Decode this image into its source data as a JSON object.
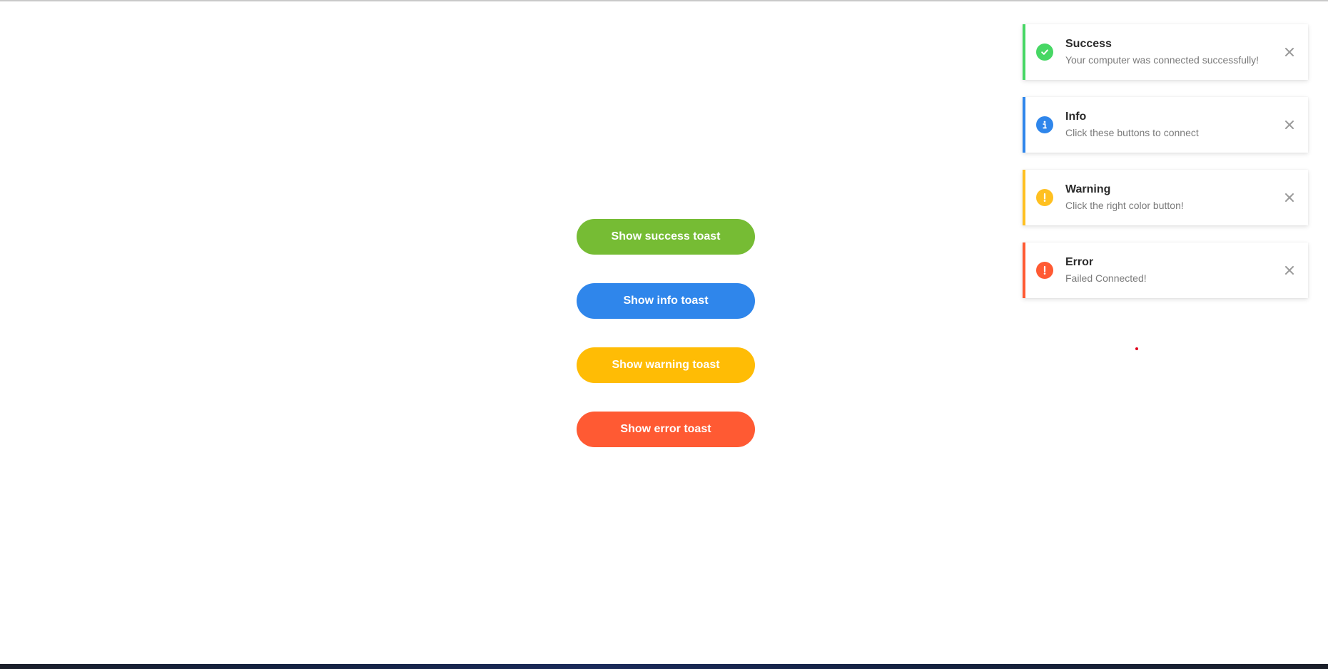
{
  "buttons": [
    {
      "label": "Show success toast",
      "color": "#76bc34"
    },
    {
      "label": "Show info toast",
      "color": "#2f86eb"
    },
    {
      "label": "Show warning toast",
      "color": "#ffbc05"
    },
    {
      "label": "Show error toast",
      "color": "#ff5a33"
    }
  ],
  "toasts": [
    {
      "title": "Success",
      "message": "Your computer was connected successfully!",
      "color": "#47d764",
      "icon": "check-circle-icon"
    },
    {
      "title": "Info",
      "message": "Click these buttons to connect",
      "color": "#2f86eb",
      "icon": "info-circle-icon"
    },
    {
      "title": "Warning",
      "message": "Click the right color button!",
      "color": "#ffc021",
      "icon": "exclamation-circle-icon"
    },
    {
      "title": "Error",
      "message": "Failed Connected!",
      "color": "#ff5a33",
      "icon": "exclamation-circle-icon"
    }
  ],
  "close_icon": "close-icon",
  "close_color": "#9a9a9a",
  "dot_color": "#e0001b"
}
